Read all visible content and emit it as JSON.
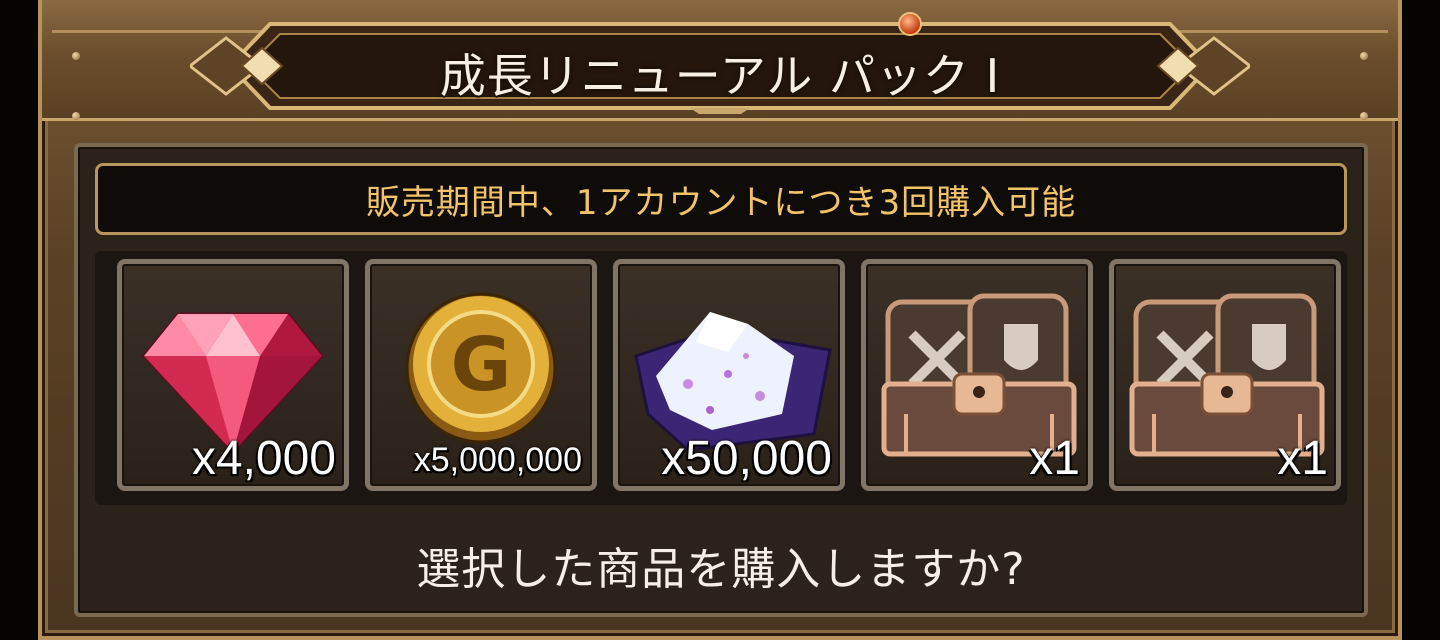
{
  "dialog": {
    "title": "成長リニューアル パック Ⅰ",
    "notice": "販売期間中、1アカウントにつき3回購入可能",
    "question": "選択した商品を購入しますか?"
  },
  "items": [
    {
      "name": "ruby-gem",
      "icon": "ruby-gem-icon",
      "quantity": "x4,000"
    },
    {
      "name": "gold-coin",
      "icon": "gold-coin-icon",
      "quantity": "x5,000,000"
    },
    {
      "name": "crystal-dust",
      "icon": "crystal-dust-icon",
      "quantity": "x50,000"
    },
    {
      "name": "equipment-chest-1",
      "icon": "treasure-chest-icon",
      "quantity": "x1"
    },
    {
      "name": "equipment-chest-2",
      "icon": "treasure-chest-icon",
      "quantity": "x1"
    }
  ],
  "colors": {
    "notice_text": "#f2c46a",
    "frame_gold": "#c9a66b",
    "panel_bg": "#2b2319"
  }
}
